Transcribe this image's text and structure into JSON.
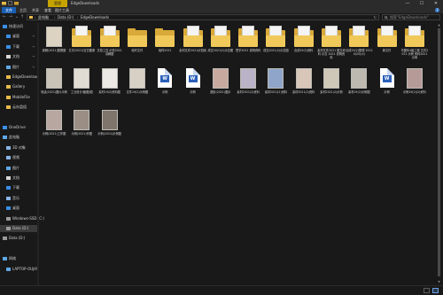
{
  "titlebar": {
    "context_tab": "管理",
    "title": "EdgeDownloads",
    "minimize": "—",
    "maximize": "☐",
    "close": "✕"
  },
  "ribbon": {
    "tabs": [
      "文件",
      "主页",
      "共享",
      "查看",
      "图片工具"
    ],
    "help": "?"
  },
  "address": {
    "back": "←",
    "forward": "→",
    "recent": "⌄",
    "up": "↑",
    "crumbs": [
      "此电脑",
      "Data (D:)",
      "EdgeDownloads"
    ],
    "separator": "›",
    "refresh": "↻",
    "search_placeholder": "搜索\"EdgeDownloads\""
  },
  "nav": {
    "items": [
      {
        "label": "快速访问",
        "icon": "star-icon",
        "pinned": false,
        "indent": 0
      },
      {
        "label": "桌面",
        "icon": "desktop-icon",
        "pinned": true,
        "indent": 1
      },
      {
        "label": "下载",
        "icon": "download-icon",
        "pinned": true,
        "indent": 1
      },
      {
        "label": "文档",
        "icon": "document-icon",
        "pinned": true,
        "indent": 1
      },
      {
        "label": "图片",
        "icon": "picture-icon",
        "pinned": true,
        "indent": 1
      },
      {
        "label": "EdgeDownload",
        "icon": "folder-icon",
        "pinned": false,
        "indent": 1
      },
      {
        "label": "Gallery",
        "icon": "folder-icon",
        "pinned": false,
        "indent": 1
      },
      {
        "label": "MobileFile",
        "icon": "folder-icon",
        "pinned": false,
        "indent": 1
      },
      {
        "label": "云存盘组",
        "icon": "folder-icon",
        "pinned": false,
        "indent": 1
      },
      {
        "label": "",
        "icon": "",
        "pinned": false,
        "indent": 0
      },
      {
        "label": "OneDrive",
        "icon": "cloud-icon",
        "pinned": false,
        "indent": 0
      },
      {
        "label": "此电脑",
        "icon": "computer-icon",
        "pinned": false,
        "indent": 0
      },
      {
        "label": "3D 对象",
        "icon": "cube-icon",
        "pinned": false,
        "indent": 1
      },
      {
        "label": "视频",
        "icon": "video-icon",
        "pinned": false,
        "indent": 1
      },
      {
        "label": "图片",
        "icon": "picture-icon",
        "pinned": false,
        "indent": 1
      },
      {
        "label": "文档",
        "icon": "document-icon",
        "pinned": false,
        "indent": 1
      },
      {
        "label": "下载",
        "icon": "download-icon",
        "pinned": false,
        "indent": 1
      },
      {
        "label": "音乐",
        "icon": "music-icon",
        "pinned": false,
        "indent": 1
      },
      {
        "label": "桌面",
        "icon": "desktop-icon",
        "pinned": false,
        "indent": 1
      },
      {
        "label": "Windows-SSD (C:)",
        "icon": "drive-icon",
        "pinned": false,
        "indent": 1
      },
      {
        "label": "Data (D:)",
        "icon": "drive-icon",
        "pinned": false,
        "indent": 1,
        "selected": true
      },
      {
        "label": "Data (D:)",
        "icon": "drive-icon",
        "pinned": false,
        "indent": 0
      },
      {
        "label": "",
        "icon": "",
        "pinned": false,
        "indent": 0
      },
      {
        "label": "网络",
        "icon": "network-icon",
        "pinned": false,
        "indent": 0
      },
      {
        "label": "LAPTOP-OUJ49",
        "icon": "computer-icon",
        "pinned": false,
        "indent": 1
      }
    ]
  },
  "files": [
    {
      "name": "原稿(2021)整理图",
      "type": "photo",
      "tint": "#dcd3c2"
    },
    {
      "name": "文字(2021)空白图册",
      "type": "folder-doc"
    },
    {
      "name": "文档工具 示范2021 讲解图",
      "type": "folder-doc"
    },
    {
      "name": "临时文件",
      "type": "folder"
    },
    {
      "name": "临时2021",
      "type": "folder"
    },
    {
      "name": "素材文件2021示范版",
      "type": "folder-doc"
    },
    {
      "name": "成交2021(2)示意图",
      "type": "folder-doc"
    },
    {
      "name": "签字2021 说明资料",
      "type": "folder-doc"
    },
    {
      "name": "成交2021(2)示意图",
      "type": "folder-doc"
    },
    {
      "name": "合成19(2)资料",
      "type": "folder-doc"
    },
    {
      "name": "素材文件2021 图文资料 示意 2021 说明资料",
      "type": "folder-doc"
    },
    {
      "name": "合成19(2)整理 19120(20)(4)",
      "type": "folder-doc"
    },
    {
      "name": "新文件",
      "type": "folder-doc"
    },
    {
      "name": "华图年4级工程 文件2021 示例 资料2021 示例",
      "type": "folder-doc"
    },
    {
      "name": "电话(2021)图片示例",
      "type": "photo",
      "tint": "#c9c2b6"
    },
    {
      "name": "工业设计(截图)图",
      "type": "photo",
      "tint": "#e2ddd4"
    },
    {
      "name": "素材19(2)资料图",
      "type": "photo",
      "tint": "#ece9e4"
    },
    {
      "name": "文件19(2)示例图",
      "type": "photo",
      "tint": "#d7d0c5"
    },
    {
      "name": "示例",
      "type": "word"
    },
    {
      "name": "示例",
      "type": "word"
    },
    {
      "name": "造影(2021)图示",
      "type": "photo",
      "tint": "#c8a9a0"
    },
    {
      "name": "素材2021(2)资料",
      "type": "photo",
      "tint": "#b8b3c6"
    },
    {
      "name": "素材2021(2)资料",
      "type": "photo",
      "tint": "#8fa5c9"
    },
    {
      "name": "素材2021(2)资料",
      "type": "photo",
      "tint": "#d8c6b8"
    },
    {
      "name": "素材2021(2)示例",
      "type": "photo",
      "tint": "#cfc8b8"
    },
    {
      "name": "素材19(2)示例图",
      "type": "photo",
      "tint": "#bdb8b0"
    },
    {
      "name": "示例",
      "type": "word"
    },
    {
      "name": "示例19(2)(2)资料",
      "type": "photo",
      "tint": "#b59b98"
    },
    {
      "name": "示例(2021)工作图",
      "type": "photo",
      "tint": "#b8a7a0"
    },
    {
      "name": "示例(2021)作图",
      "type": "photo",
      "tint": "#9b8f85"
    },
    {
      "name": "示例(2021)示例图",
      "type": "photo",
      "tint": "#7f756c"
    }
  ],
  "status": {
    "count": "",
    "view_details": "details-view-icon",
    "view_tiles": "large-icons-view-icon"
  }
}
